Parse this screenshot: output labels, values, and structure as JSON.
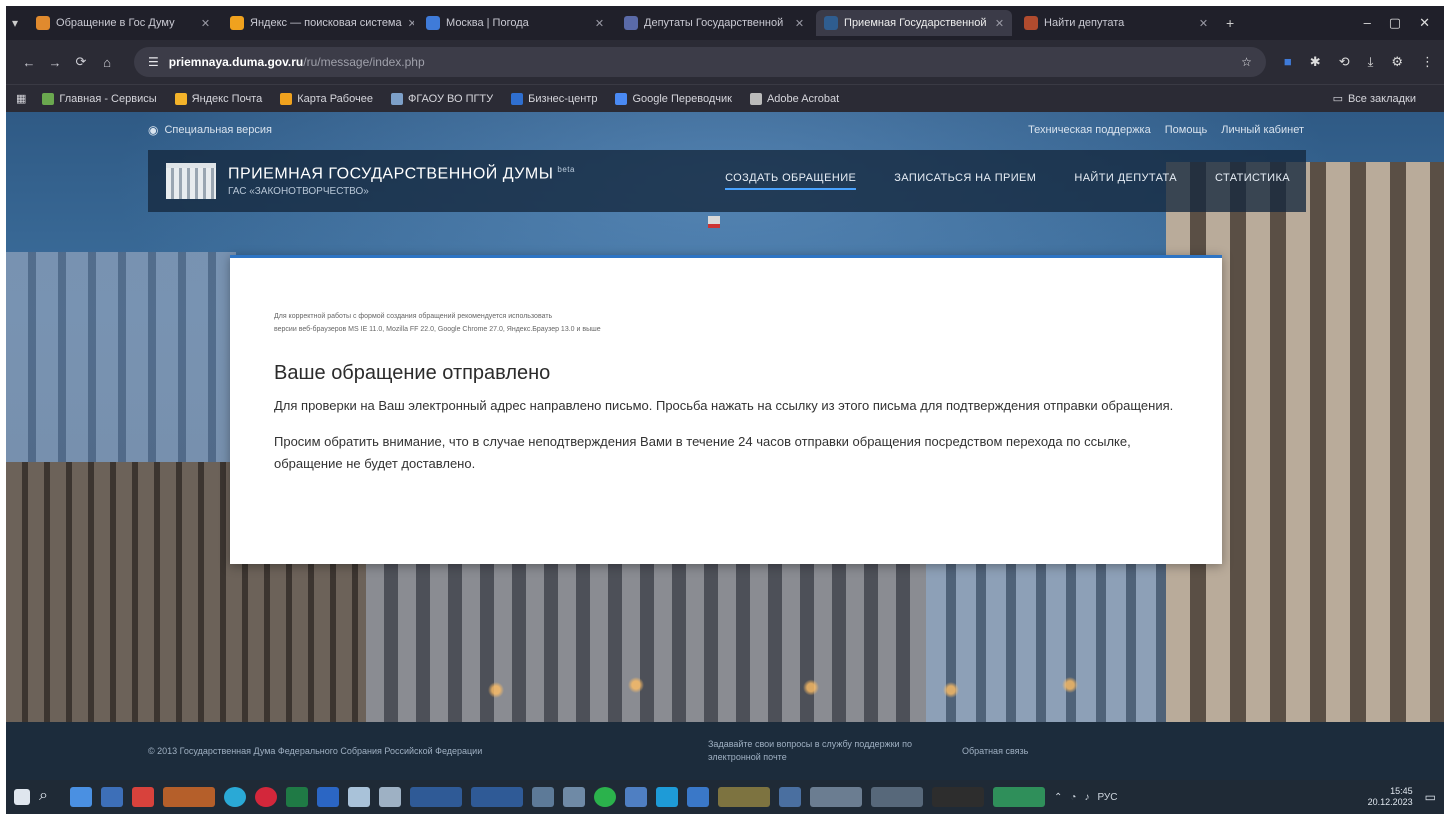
{
  "browser": {
    "tabs": [
      {
        "label": "Обращение в Гос Думу",
        "color": "#e08a2e"
      },
      {
        "label": "Яндекс — поисковая система",
        "color": "#f0a21e"
      },
      {
        "label": "Москва | Погода",
        "color": "#3f7bd9"
      },
      {
        "label": "Депутаты Государственной",
        "color": "#5a6aa8"
      },
      {
        "label": "Приемная Государственной",
        "color": "#2f5d8f"
      },
      {
        "label": "Найти депутата",
        "color": "#b04b2e"
      }
    ],
    "url_host": "priemnaya.duma.gov.ru",
    "url_path": "/ru/message/index.php",
    "bookmarks": [
      {
        "label": "Главная - Сервисы",
        "color": "#6aa84f"
      },
      {
        "label": "Яндекс Почта",
        "color": "#f3b32a"
      },
      {
        "label": "Карта Рабочее",
        "color": "#f0a21e"
      },
      {
        "label": "ФГАОУ ВО ПГТУ",
        "color": "#7da0c9"
      },
      {
        "label": "Бизнес-центр",
        "color": "#2f6fd0"
      },
      {
        "label": "Google Переводчик",
        "color": "#4a8af4"
      },
      {
        "label": "Adobe Acrobat",
        "color": "#bbbbbb"
      }
    ],
    "bookmarks_all": "Все закладки"
  },
  "site": {
    "special_version": "Специальная версия",
    "top_links": [
      "Техническая поддержка",
      "Помощь",
      "Личный кабинет"
    ],
    "brand_title": "ПРИЕМНАЯ ГОСУДАРСТВЕННОЙ ДУМЫ",
    "brand_beta": "beta",
    "brand_subtitle": "ГАС «ЗАКОНОТВОРЧЕСТВО»",
    "nav": [
      "СОЗДАТЬ ОБРАЩЕНИЕ",
      "ЗАПИСАТЬСЯ НА ПРИЕМ",
      "НАЙТИ ДЕПУТАТА",
      "СТАТИСТИКА"
    ]
  },
  "card": {
    "notice_line1": "Для корректной работы с формой создания обращений рекомендуется использовать",
    "notice_line2": "версии веб-браузеров MS IE 11.0, Mozilla FF 22.0, Google Chrome 27.0, Яндекс.Браузер 13.0 и выше",
    "title": "Ваше обращение отправлено",
    "para1": "Для проверки на Ваш электронный адрес направлено письмо. Просьба нажать на ссылку из этого письма для подтверждения отправки обращения.",
    "para2": "Просим обратить внимание, что в случае неподтверждения Вами в течение 24 часов отправки обращения посредством перехода по ссылке, обращение не будет доставлено."
  },
  "footer": {
    "copyright": "© 2013 Государственная Дума Федерального Собрания Российской Федерации",
    "support": "Задавайте свои вопросы в службу поддержки по электронной почте",
    "send_link": "Обратная связь"
  },
  "taskbar": {
    "time": "15:45",
    "date": "20.12.2023",
    "lang": "РУС"
  }
}
